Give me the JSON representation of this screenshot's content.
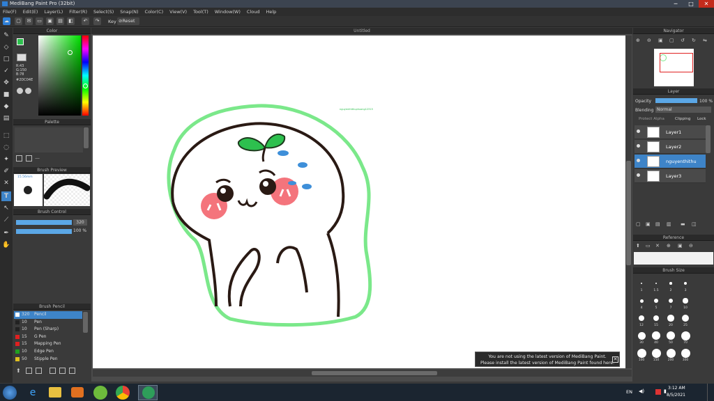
{
  "app": {
    "title": "MediBang Paint Pro (32bit)",
    "doc_title": "Untitled"
  },
  "menu": [
    "File(F)",
    "Edit(E)",
    "Layer(L)",
    "Filter(R)",
    "Select(S)",
    "Snap(N)",
    "Color(C)",
    "View(V)",
    "Tool(T)",
    "Window(W)",
    "Cloud",
    "Help"
  ],
  "toolbar": {
    "key_label": "Key",
    "reset_label": "Reset"
  },
  "color_panel": {
    "title": "Color",
    "r": "R:43",
    "g": "G:150",
    "b": "B:78",
    "hex": "#2DC04E"
  },
  "palette_panel": {
    "title": "Palette"
  },
  "brush_preview": {
    "title": "Brush Preview",
    "size": "15.56mm"
  },
  "brush_control": {
    "title": "Brush Control",
    "size_value": "320",
    "opacity_value": "100 %"
  },
  "brush_panel": {
    "title": "Brush Pencil",
    "items": [
      {
        "size": "320",
        "name": "Pencil",
        "color": "#ffffff"
      },
      {
        "size": "10",
        "name": "Pen",
        "color": "#222222"
      },
      {
        "size": "10",
        "name": "Pen (Sharp)",
        "color": "#222222"
      },
      {
        "size": "15",
        "name": "G Pen",
        "color": "#e02020"
      },
      {
        "size": "15",
        "name": "Mapping Pen",
        "color": "#e02020"
      },
      {
        "size": "10",
        "name": "Edge Pen",
        "color": "#20a020"
      },
      {
        "size": "50",
        "name": "Stipple Pen",
        "color": "#e0c020"
      }
    ]
  },
  "navigator": {
    "title": "Navigator"
  },
  "layer_panel": {
    "title": "Layer",
    "opacity_label": "Opacity",
    "opacity_value": "100 %",
    "blending_label": "Blending",
    "blending_value": "Normal",
    "protect_alpha": "Protect Alpha",
    "clipping": "Clipping",
    "lock": "Lock",
    "layers": [
      {
        "name": "Layer1"
      },
      {
        "name": "Layer2"
      },
      {
        "name": "nguyenthithu"
      },
      {
        "name": "Layer3"
      }
    ]
  },
  "reference": {
    "title": "Reference"
  },
  "brush_size": {
    "title": "Brush Size",
    "sizes": [
      "1",
      "1.5",
      "2",
      "3",
      "4",
      "5",
      "7",
      "10",
      "12",
      "15",
      "20",
      "25",
      "30",
      "40",
      "50",
      "70",
      "100",
      "150",
      "200",
      "300"
    ]
  },
  "canvas_text": "nguyenthithuphuong12315",
  "toast": {
    "line1": "You are not using the latest version of MediBang Paint.",
    "line2": "Please install the latest version of MediBang Paint found here."
  },
  "taskbar": {
    "lang": "EN",
    "time": "3:12 AM",
    "date": "8/5/2021"
  },
  "colors": {
    "accent": "#3e84c8",
    "outline_green": "#7be88a",
    "leaf_green": "#2dc04e",
    "cheek": "#f4747c"
  }
}
